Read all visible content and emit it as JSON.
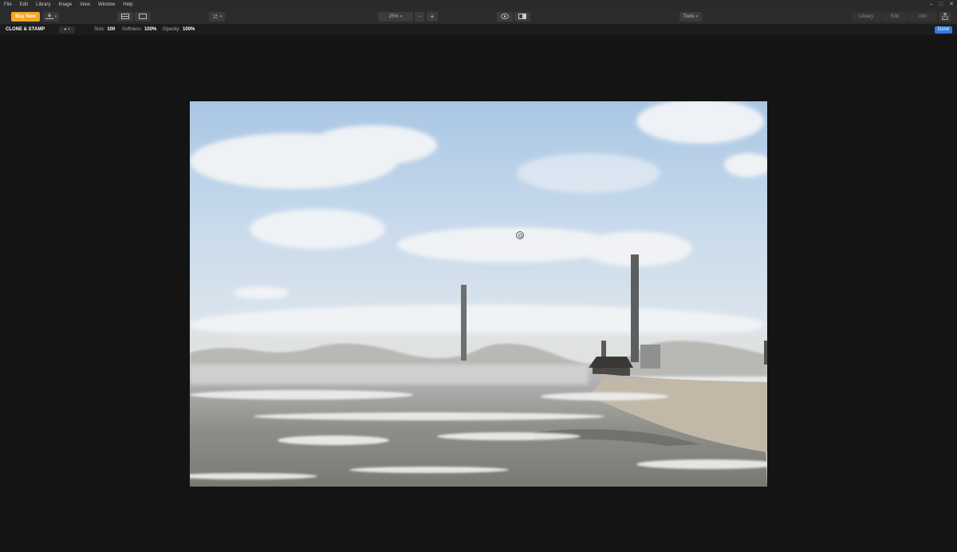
{
  "menu": {
    "items": [
      "File",
      "Edit",
      "Library",
      "Image",
      "View",
      "Window",
      "Help"
    ]
  },
  "window_controls": {
    "minimize": "–",
    "maximize": "□",
    "close": "✕"
  },
  "toolbar": {
    "buy_now_label": "Buy Now",
    "zoom_value": "25%",
    "tools_label": "Tools",
    "tabs": [
      "Library",
      "Edit",
      "Info"
    ]
  },
  "icons": {
    "export": "export-icon",
    "grid_view": "grid-view-icon",
    "single_view": "single-view-icon",
    "compare": "compare-icon",
    "zoom_out": "minus-icon",
    "zoom_in": "plus-icon",
    "preview": "eye-icon",
    "split": "split-view-icon",
    "share": "share-icon",
    "brush": "brush-icon"
  },
  "options": {
    "tool_name": "CLONE & STAMP",
    "size_label": "Size:",
    "size_value": "100",
    "softness_label": "Softness:",
    "softness_value": "100%",
    "opacity_label": "Opacity:",
    "opacity_value": "100%",
    "done_label": "Done"
  },
  "colors": {
    "accent_buy": "#f5a623",
    "accent_done": "#2f7de1",
    "background": "#141414"
  }
}
